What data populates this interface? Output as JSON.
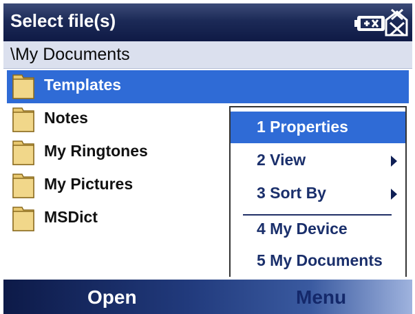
{
  "titlebar": {
    "title": "Select file(s)",
    "icons": [
      "battery-icon",
      "no-signal-icon"
    ]
  },
  "path": "\\My Documents",
  "files": [
    {
      "name": "Templates",
      "icon": "folder-icon",
      "selected": true
    },
    {
      "name": "Notes",
      "icon": "folder-icon",
      "selected": false
    },
    {
      "name": "My Ringtones",
      "icon": "folder-icon",
      "selected": false
    },
    {
      "name": "My Pictures",
      "icon": "folder-icon",
      "selected": false
    },
    {
      "name": "MSDict",
      "icon": "folder-icon",
      "selected": false
    }
  ],
  "context_menu": {
    "items": [
      {
        "label": "1 Properties",
        "submenu": false,
        "selected": true
      },
      {
        "label": "2 View",
        "submenu": true,
        "selected": false
      },
      {
        "label": "3 Sort By",
        "submenu": true,
        "selected": false
      },
      {
        "label": "4 My Device",
        "submenu": false,
        "selected": false
      },
      {
        "label": "5 My Documents",
        "submenu": false,
        "selected": false
      }
    ]
  },
  "softkeys": {
    "left": "Open",
    "right": "Menu"
  },
  "colors": {
    "selection": "#2f6bd6",
    "titlebar": "#1c2a57",
    "pathbar": "#dbe0ee",
    "folder": "#e8c870"
  }
}
